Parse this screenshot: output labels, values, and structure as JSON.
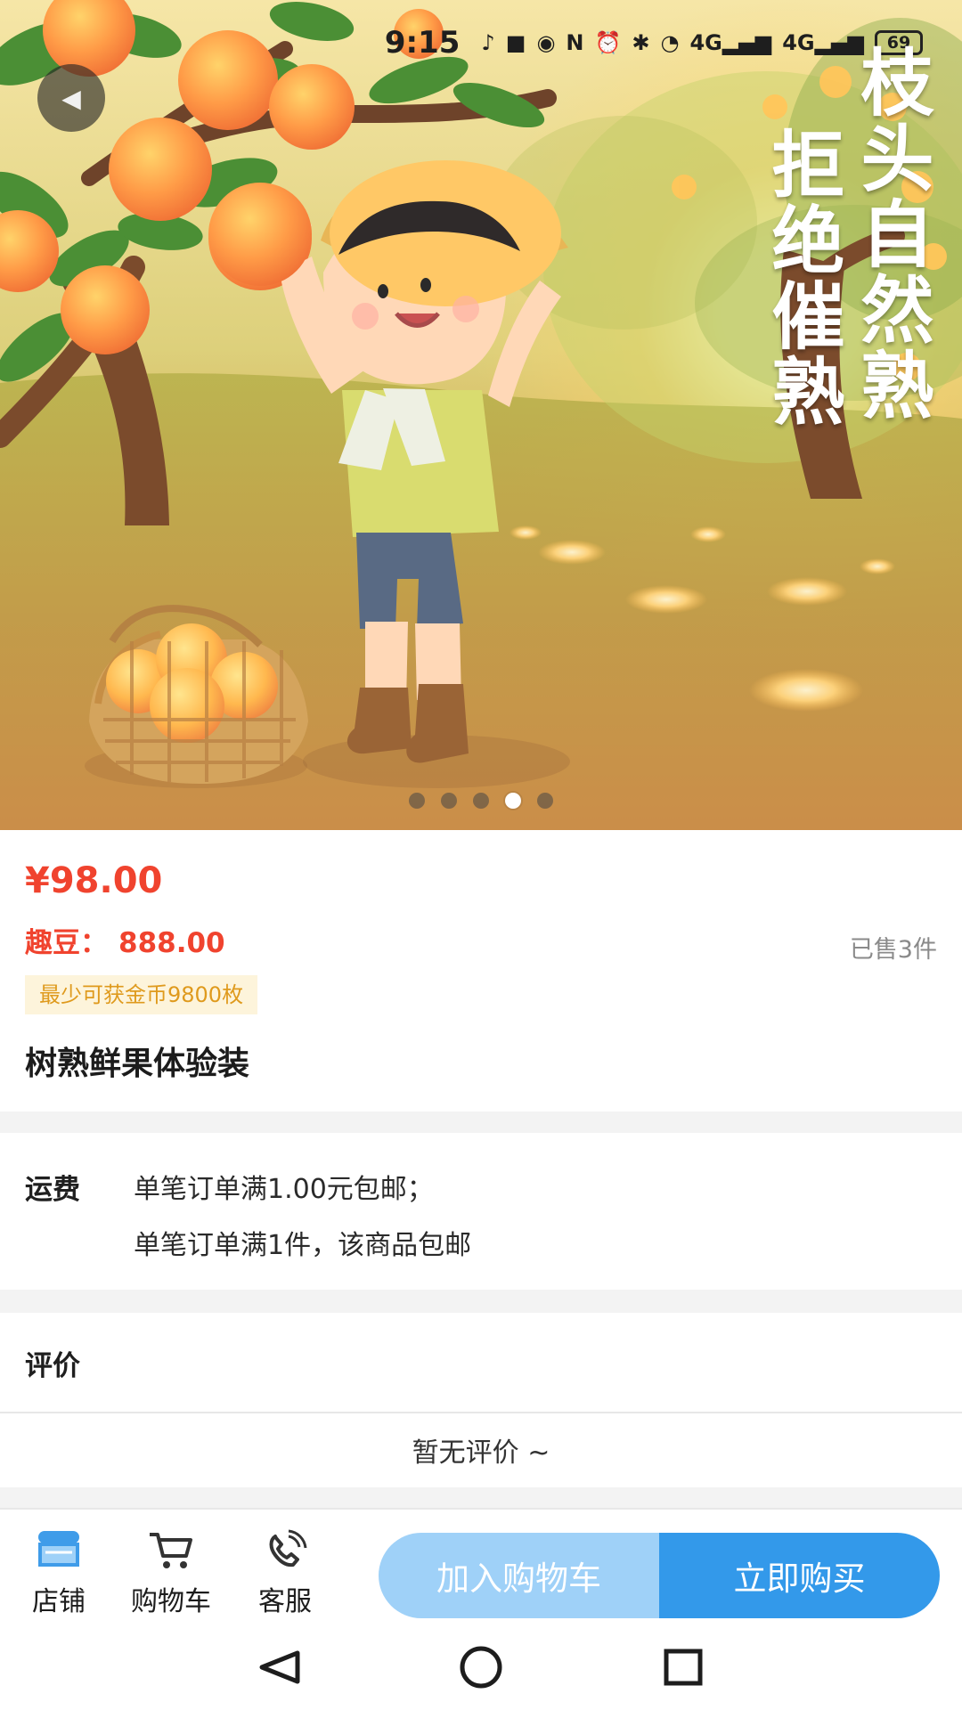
{
  "status_bar": {
    "time": "9:15",
    "network_4g_1": "4G",
    "network_4g_2": "4G",
    "battery": "69"
  },
  "hero": {
    "slogan_right": "枝头自然熟",
    "slogan_left": "拒绝催熟",
    "page_count": 5,
    "active_page": 4
  },
  "product": {
    "price": "¥98.00",
    "points_label": "趣豆：",
    "points_value": "888.00",
    "sold": "已售3件",
    "coin_badge": "最少可获金币9800枚",
    "name": "树熟鲜果体验装"
  },
  "shipping": {
    "title": "运费",
    "line1": "单笔订单满1.00元包邮；",
    "line2": "单笔订单满1件，该商品包邮"
  },
  "reviews": {
    "title": "评价",
    "empty": "暂无评价 ~"
  },
  "bottom_bar": {
    "store": "店铺",
    "cart": "购物车",
    "service": "客服",
    "add_to_cart": "加入购物车",
    "buy_now": "立即购买"
  }
}
